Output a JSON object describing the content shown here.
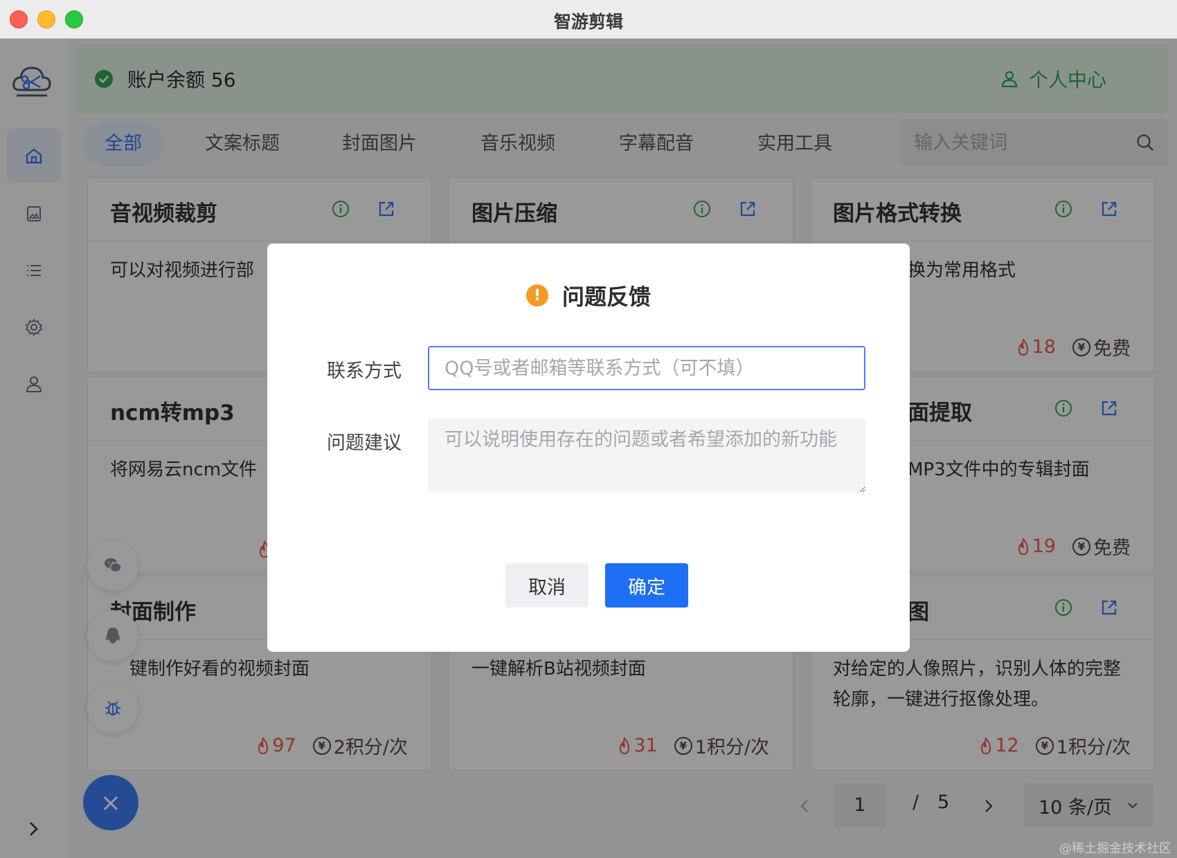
{
  "window": {
    "title": "智游剪辑"
  },
  "header": {
    "balance_label": "账户余额 56",
    "personal_center": "个人中心"
  },
  "tabs": [
    {
      "label": "全部",
      "active": true
    },
    {
      "label": "文案标题"
    },
    {
      "label": "封面图片"
    },
    {
      "label": "音乐视频"
    },
    {
      "label": "字幕配音"
    },
    {
      "label": "实用工具"
    }
  ],
  "search": {
    "placeholder": "输入关键词"
  },
  "cards": [
    {
      "title": "音视频裁剪",
      "desc": "可以对视频进行部"
    },
    {
      "title": "图片压缩",
      "desc": ""
    },
    {
      "title": "图片格式转换",
      "desc": "换为常用格式",
      "heat": "18",
      "price": "免费"
    },
    {
      "title": "ncm转mp3",
      "desc": "将网易云ncm文件"
    },
    {
      "title": "",
      "desc": ""
    },
    {
      "title": "面提取",
      "desc": "MP3文件中的专辑封面",
      "heat": "19",
      "price": "免费"
    },
    {
      "title": "封面制作",
      "desc": "键制作好看的视频封面",
      "heat": "97",
      "price": "2积分/次"
    },
    {
      "title": "",
      "desc": "一键解析B站视频封面",
      "heat": "31",
      "price": "1积分/次"
    },
    {
      "title": "图",
      "desc": "对给定的人像照片，识别人体的完整轮廓，一键进行抠像处理。",
      "heat": "12",
      "price": "1积分/次"
    }
  ],
  "pagination": {
    "current": "1",
    "separator": "/",
    "total": "5",
    "page_size": "10 条/页"
  },
  "watermark": "@稀土掘金技术社区",
  "dialog": {
    "title": "问题反馈",
    "contact_label": "联系方式",
    "contact_placeholder": "QQ号或者邮箱等联系方式（可不填）",
    "suggestion_label": "问题建议",
    "suggestion_placeholder": "可以说明使用存在的问题或者希望添加的新功能",
    "cancel": "取消",
    "confirm": "确定"
  },
  "colors": {
    "primary": "#1e6ef6",
    "success": "#2fa84f",
    "warning": "#f59a23",
    "heat": "#f05a4a"
  }
}
